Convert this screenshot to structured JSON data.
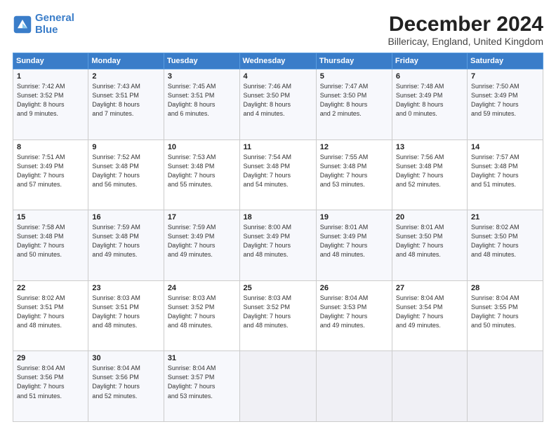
{
  "logo": {
    "line1": "General",
    "line2": "Blue"
  },
  "header": {
    "title": "December 2024",
    "subtitle": "Billericay, England, United Kingdom"
  },
  "columns": [
    "Sunday",
    "Monday",
    "Tuesday",
    "Wednesday",
    "Thursday",
    "Friday",
    "Saturday"
  ],
  "weeks": [
    [
      {
        "day": "1",
        "detail": "Sunrise: 7:42 AM\nSunset: 3:52 PM\nDaylight: 8 hours\nand 9 minutes."
      },
      {
        "day": "2",
        "detail": "Sunrise: 7:43 AM\nSunset: 3:51 PM\nDaylight: 8 hours\nand 7 minutes."
      },
      {
        "day": "3",
        "detail": "Sunrise: 7:45 AM\nSunset: 3:51 PM\nDaylight: 8 hours\nand 6 minutes."
      },
      {
        "day": "4",
        "detail": "Sunrise: 7:46 AM\nSunset: 3:50 PM\nDaylight: 8 hours\nand 4 minutes."
      },
      {
        "day": "5",
        "detail": "Sunrise: 7:47 AM\nSunset: 3:50 PM\nDaylight: 8 hours\nand 2 minutes."
      },
      {
        "day": "6",
        "detail": "Sunrise: 7:48 AM\nSunset: 3:49 PM\nDaylight: 8 hours\nand 0 minutes."
      },
      {
        "day": "7",
        "detail": "Sunrise: 7:50 AM\nSunset: 3:49 PM\nDaylight: 7 hours\nand 59 minutes."
      }
    ],
    [
      {
        "day": "8",
        "detail": "Sunrise: 7:51 AM\nSunset: 3:49 PM\nDaylight: 7 hours\nand 57 minutes."
      },
      {
        "day": "9",
        "detail": "Sunrise: 7:52 AM\nSunset: 3:48 PM\nDaylight: 7 hours\nand 56 minutes."
      },
      {
        "day": "10",
        "detail": "Sunrise: 7:53 AM\nSunset: 3:48 PM\nDaylight: 7 hours\nand 55 minutes."
      },
      {
        "day": "11",
        "detail": "Sunrise: 7:54 AM\nSunset: 3:48 PM\nDaylight: 7 hours\nand 54 minutes."
      },
      {
        "day": "12",
        "detail": "Sunrise: 7:55 AM\nSunset: 3:48 PM\nDaylight: 7 hours\nand 53 minutes."
      },
      {
        "day": "13",
        "detail": "Sunrise: 7:56 AM\nSunset: 3:48 PM\nDaylight: 7 hours\nand 52 minutes."
      },
      {
        "day": "14",
        "detail": "Sunrise: 7:57 AM\nSunset: 3:48 PM\nDaylight: 7 hours\nand 51 minutes."
      }
    ],
    [
      {
        "day": "15",
        "detail": "Sunrise: 7:58 AM\nSunset: 3:48 PM\nDaylight: 7 hours\nand 50 minutes."
      },
      {
        "day": "16",
        "detail": "Sunrise: 7:59 AM\nSunset: 3:48 PM\nDaylight: 7 hours\nand 49 minutes."
      },
      {
        "day": "17",
        "detail": "Sunrise: 7:59 AM\nSunset: 3:49 PM\nDaylight: 7 hours\nand 49 minutes."
      },
      {
        "day": "18",
        "detail": "Sunrise: 8:00 AM\nSunset: 3:49 PM\nDaylight: 7 hours\nand 48 minutes."
      },
      {
        "day": "19",
        "detail": "Sunrise: 8:01 AM\nSunset: 3:49 PM\nDaylight: 7 hours\nand 48 minutes."
      },
      {
        "day": "20",
        "detail": "Sunrise: 8:01 AM\nSunset: 3:50 PM\nDaylight: 7 hours\nand 48 minutes."
      },
      {
        "day": "21",
        "detail": "Sunrise: 8:02 AM\nSunset: 3:50 PM\nDaylight: 7 hours\nand 48 minutes."
      }
    ],
    [
      {
        "day": "22",
        "detail": "Sunrise: 8:02 AM\nSunset: 3:51 PM\nDaylight: 7 hours\nand 48 minutes."
      },
      {
        "day": "23",
        "detail": "Sunrise: 8:03 AM\nSunset: 3:51 PM\nDaylight: 7 hours\nand 48 minutes."
      },
      {
        "day": "24",
        "detail": "Sunrise: 8:03 AM\nSunset: 3:52 PM\nDaylight: 7 hours\nand 48 minutes."
      },
      {
        "day": "25",
        "detail": "Sunrise: 8:03 AM\nSunset: 3:52 PM\nDaylight: 7 hours\nand 48 minutes."
      },
      {
        "day": "26",
        "detail": "Sunrise: 8:04 AM\nSunset: 3:53 PM\nDaylight: 7 hours\nand 49 minutes."
      },
      {
        "day": "27",
        "detail": "Sunrise: 8:04 AM\nSunset: 3:54 PM\nDaylight: 7 hours\nand 49 minutes."
      },
      {
        "day": "28",
        "detail": "Sunrise: 8:04 AM\nSunset: 3:55 PM\nDaylight: 7 hours\nand 50 minutes."
      }
    ],
    [
      {
        "day": "29",
        "detail": "Sunrise: 8:04 AM\nSunset: 3:56 PM\nDaylight: 7 hours\nand 51 minutes."
      },
      {
        "day": "30",
        "detail": "Sunrise: 8:04 AM\nSunset: 3:56 PM\nDaylight: 7 hours\nand 52 minutes."
      },
      {
        "day": "31",
        "detail": "Sunrise: 8:04 AM\nSunset: 3:57 PM\nDaylight: 7 hours\nand 53 minutes."
      },
      null,
      null,
      null,
      null
    ]
  ]
}
